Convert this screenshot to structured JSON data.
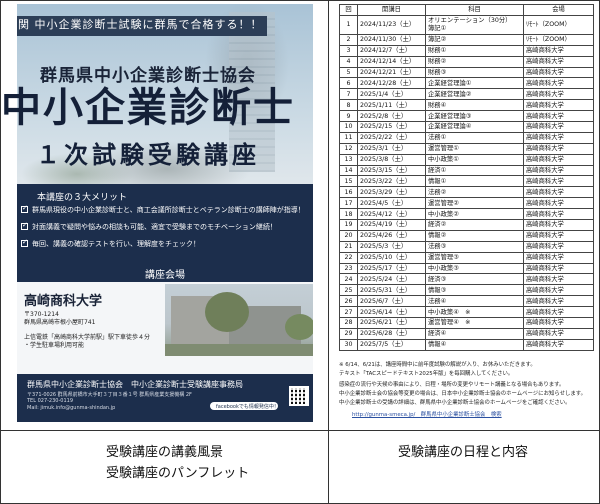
{
  "brochure": {
    "tagline": "難関 中小企業診断士試験に群馬で合格する！！",
    "association": "群馬県中小企業診断士協会",
    "title": "中小企業診断士",
    "subtitle": "１次試験受験講座",
    "merits_heading": "本講座の３大メリット",
    "merits": [
      "群馬県現役の中小企業診断士と、商工会議所診断士とベテラン診断士の講師陣が指導！",
      "対面講義で疑問や悩みの相談も可能、適宜で受験までのモチベーション継続！",
      "毎回、講義の確認テストを行い、理解度をチェック！"
    ],
    "venue_heading": "講座会場",
    "venue_name": "高崎商科大学",
    "address": [
      "〒370-1214",
      "群馬県高崎市根小屋町741"
    ],
    "access": [
      "上信電鉄「高崎商科大学前駅」駅下車徒歩４分",
      "・学生駐車場利用可能"
    ],
    "footer_orgs": "群馬県中小企業診断士協会　中小企業診断士受験講座事務局",
    "contact": [
      "〒371-0026 群馬県前橋市大手町３丁目３番１号 群馬県産業支援機構 2F",
      "TEL 027-230-0119",
      "Mail: jimuk.info@gunma-shindan.jp"
    ],
    "facebook_label": "facebookでも情報発信中！"
  },
  "schedule": {
    "headers": [
      "回",
      "開講日",
      "科目",
      "会場"
    ],
    "rows": [
      {
        "no": "1",
        "date": "2024/11/23（土）",
        "subject": "オリエンテーション（30分）",
        "subject2": "簿記①",
        "venue": "ﾘﾓｰﾄ（ZOOM）"
      },
      {
        "no": "2",
        "date": "2024/11/30（土）",
        "subject": "簿記②",
        "venue": "ﾘﾓｰﾄ（ZOOM）"
      },
      {
        "no": "3",
        "date": "2024/12/7（土）",
        "subject": "財務①",
        "venue": "高崎商科大学"
      },
      {
        "no": "4",
        "date": "2024/12/14（土）",
        "subject": "財務②",
        "venue": "高崎商科大学"
      },
      {
        "no": "5",
        "date": "2024/12/21（土）",
        "subject": "財務③",
        "venue": "高崎商科大学"
      },
      {
        "no": "6",
        "date": "2024/12/28（土）",
        "subject": "企業経営理論①",
        "venue": "高崎商科大学"
      },
      {
        "no": "7",
        "date": "2025/1/4（土）",
        "subject": "企業経営理論②",
        "venue": "高崎商科大学"
      },
      {
        "no": "8",
        "date": "2025/1/11（土）",
        "subject": "財務④",
        "venue": "高崎商科大学"
      },
      {
        "no": "9",
        "date": "2025/2/8（土）",
        "subject": "企業経営理論③",
        "venue": "高崎商科大学"
      },
      {
        "no": "10",
        "date": "2025/2/15（土）",
        "subject": "企業経営理論④",
        "venue": "高崎商科大学"
      },
      {
        "no": "11",
        "date": "2025/2/22（土）",
        "subject": "法務①",
        "venue": "高崎商科大学"
      },
      {
        "no": "12",
        "date": "2025/3/1（土）",
        "subject": "運営管理①",
        "venue": "高崎商科大学"
      },
      {
        "no": "13",
        "date": "2025/3/8（土）",
        "subject": "中小政策①",
        "venue": "高崎商科大学"
      },
      {
        "no": "14",
        "date": "2025/3/15（土）",
        "subject": "経済①",
        "venue": "高崎商科大学"
      },
      {
        "no": "15",
        "date": "2025/3/22（土）",
        "subject": "情報①",
        "venue": "高崎商科大学"
      },
      {
        "no": "16",
        "date": "2025/3/29（土）",
        "subject": "法務②",
        "venue": "高崎商科大学"
      },
      {
        "no": "17",
        "date": "2025/4/5（土）",
        "subject": "運営管理②",
        "venue": "高崎商科大学"
      },
      {
        "no": "18",
        "date": "2025/4/12（土）",
        "subject": "中小政策②",
        "venue": "高崎商科大学"
      },
      {
        "no": "19",
        "date": "2025/4/19（土）",
        "subject": "経済②",
        "venue": "高崎商科大学"
      },
      {
        "no": "20",
        "date": "2025/4/26（土）",
        "subject": "情報②",
        "venue": "高崎商科大学"
      },
      {
        "no": "21",
        "date": "2025/5/3（土）",
        "subject": "法務③",
        "venue": "高崎商科大学"
      },
      {
        "no": "22",
        "date": "2025/5/10（土）",
        "subject": "運営管理③",
        "venue": "高崎商科大学"
      },
      {
        "no": "23",
        "date": "2025/5/17（土）",
        "subject": "中小政策③",
        "venue": "高崎商科大学"
      },
      {
        "no": "24",
        "date": "2025/5/24（土）",
        "subject": "経済③",
        "venue": "高崎商科大学"
      },
      {
        "no": "25",
        "date": "2025/5/31（土）",
        "subject": "情報③",
        "venue": "高崎商科大学"
      },
      {
        "no": "26",
        "date": "2025/6/7（土）",
        "subject": "法務④",
        "venue": "高崎商科大学"
      },
      {
        "no": "27",
        "date": "2025/6/14（土）",
        "subject": "中小政策④　※",
        "venue": "高崎商科大学"
      },
      {
        "no": "28",
        "date": "2025/6/21（土）",
        "subject": "運営管理④　※",
        "venue": "高崎商科大学"
      },
      {
        "no": "29",
        "date": "2025/6/28（土）",
        "subject": "経済④",
        "venue": "高崎商科大学"
      },
      {
        "no": "30",
        "date": "2025/7/5（土）",
        "subject": "情報④",
        "venue": "高崎商科大学"
      }
    ],
    "notes": [
      "※ 6/14、6/21は、講座時間中に前年度試験の解説が入り、お休みいただきます。",
      "テキスト「TACスピードテキスト2025年版」を毎回購入してください。",
      "感染症の流行や天候の事由により、日程・場所の変更やリモート講義となる場合もあります。",
      "中小企業診断士会の協会等変更の場合は、日本中小企業診断士協会のホームページにお知らせします。",
      "中小企業診断士の受講の詳細は、群馬県中小企業診断士協会のホームページをご確認ください。"
    ],
    "url_note": "http://gunma-smeca.jp/　群馬県中小企業診断士協会　検索"
  },
  "captions": {
    "left_1": "受験講座の講義風景",
    "left_2": "受験講座のパンフレット",
    "right": "受験講座の日程と内容"
  }
}
